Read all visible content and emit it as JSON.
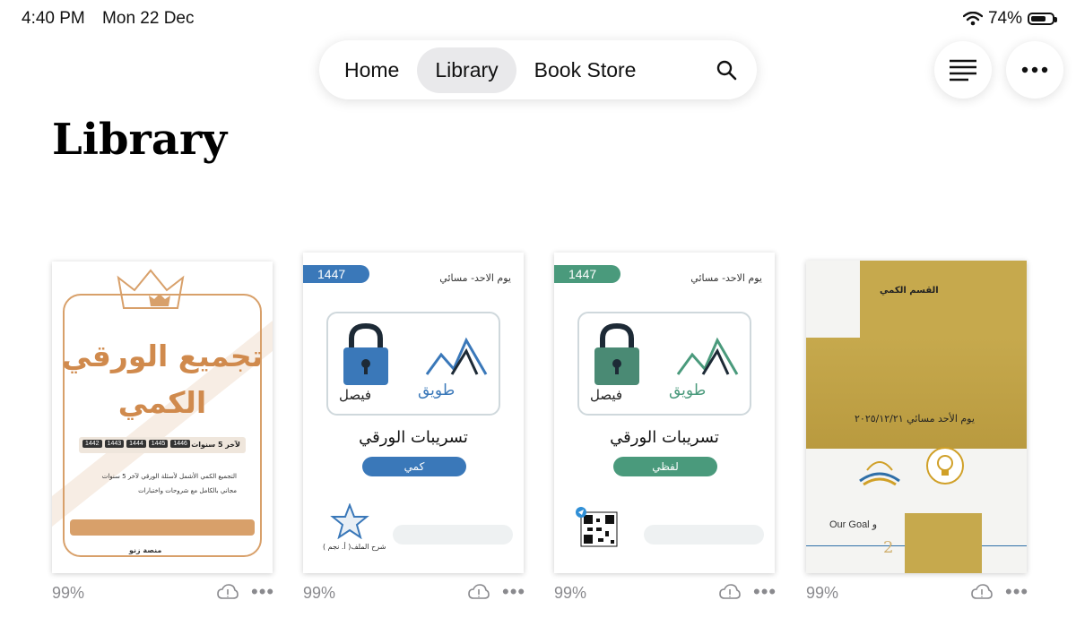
{
  "status_bar": {
    "time": "4:40 PM",
    "date": "Mon 22 Dec",
    "battery": "74%",
    "battery_level": 0.74
  },
  "nav": {
    "tabs": [
      "Home",
      "Library",
      "Book Store"
    ],
    "active": "Library"
  },
  "page_title": "Library",
  "books": [
    {
      "progress": "99%",
      "cover": {
        "title_line1": "تجميع الورقي",
        "title_line2": "الكمي",
        "subtitle": "لآخر 5 سنوات",
        "years": [
          "1442",
          "1443",
          "1444",
          "1445",
          "1446"
        ],
        "bullet1": "التجميع الكمي الأشمل لأسئلة الورقي لآخر 5 سنوات",
        "bullet2": "مجاني بالكامل مع شروحات واختبارات",
        "brand": "منصة زنو"
      }
    },
    {
      "progress": "99%",
      "cover": {
        "badge": "1447",
        "date": "يوم الاحد- مسائي",
        "logo_left": "فيصل",
        "logo_right": "طويق",
        "course": "تسريبات الورقي",
        "pill": "كمي",
        "footer_caption": "شرح الملف( أ. نجم )",
        "accent": "#3a78b9"
      }
    },
    {
      "progress": "99%",
      "cover": {
        "badge": "1447",
        "date": "يوم الاحد- مسائي",
        "logo_left": "فيصل",
        "logo_right": "طويق",
        "course": "تسريبات الورقي",
        "pill": "لفظي",
        "accent": "#4a9a7c"
      }
    },
    {
      "progress": "99%",
      "cover": {
        "section": "القسم الكمي",
        "date": "يوم الأحد مسائي ٢٠٢٥/١٢/٢١",
        "goal": "Our Goal و",
        "digit": "2"
      }
    }
  ]
}
